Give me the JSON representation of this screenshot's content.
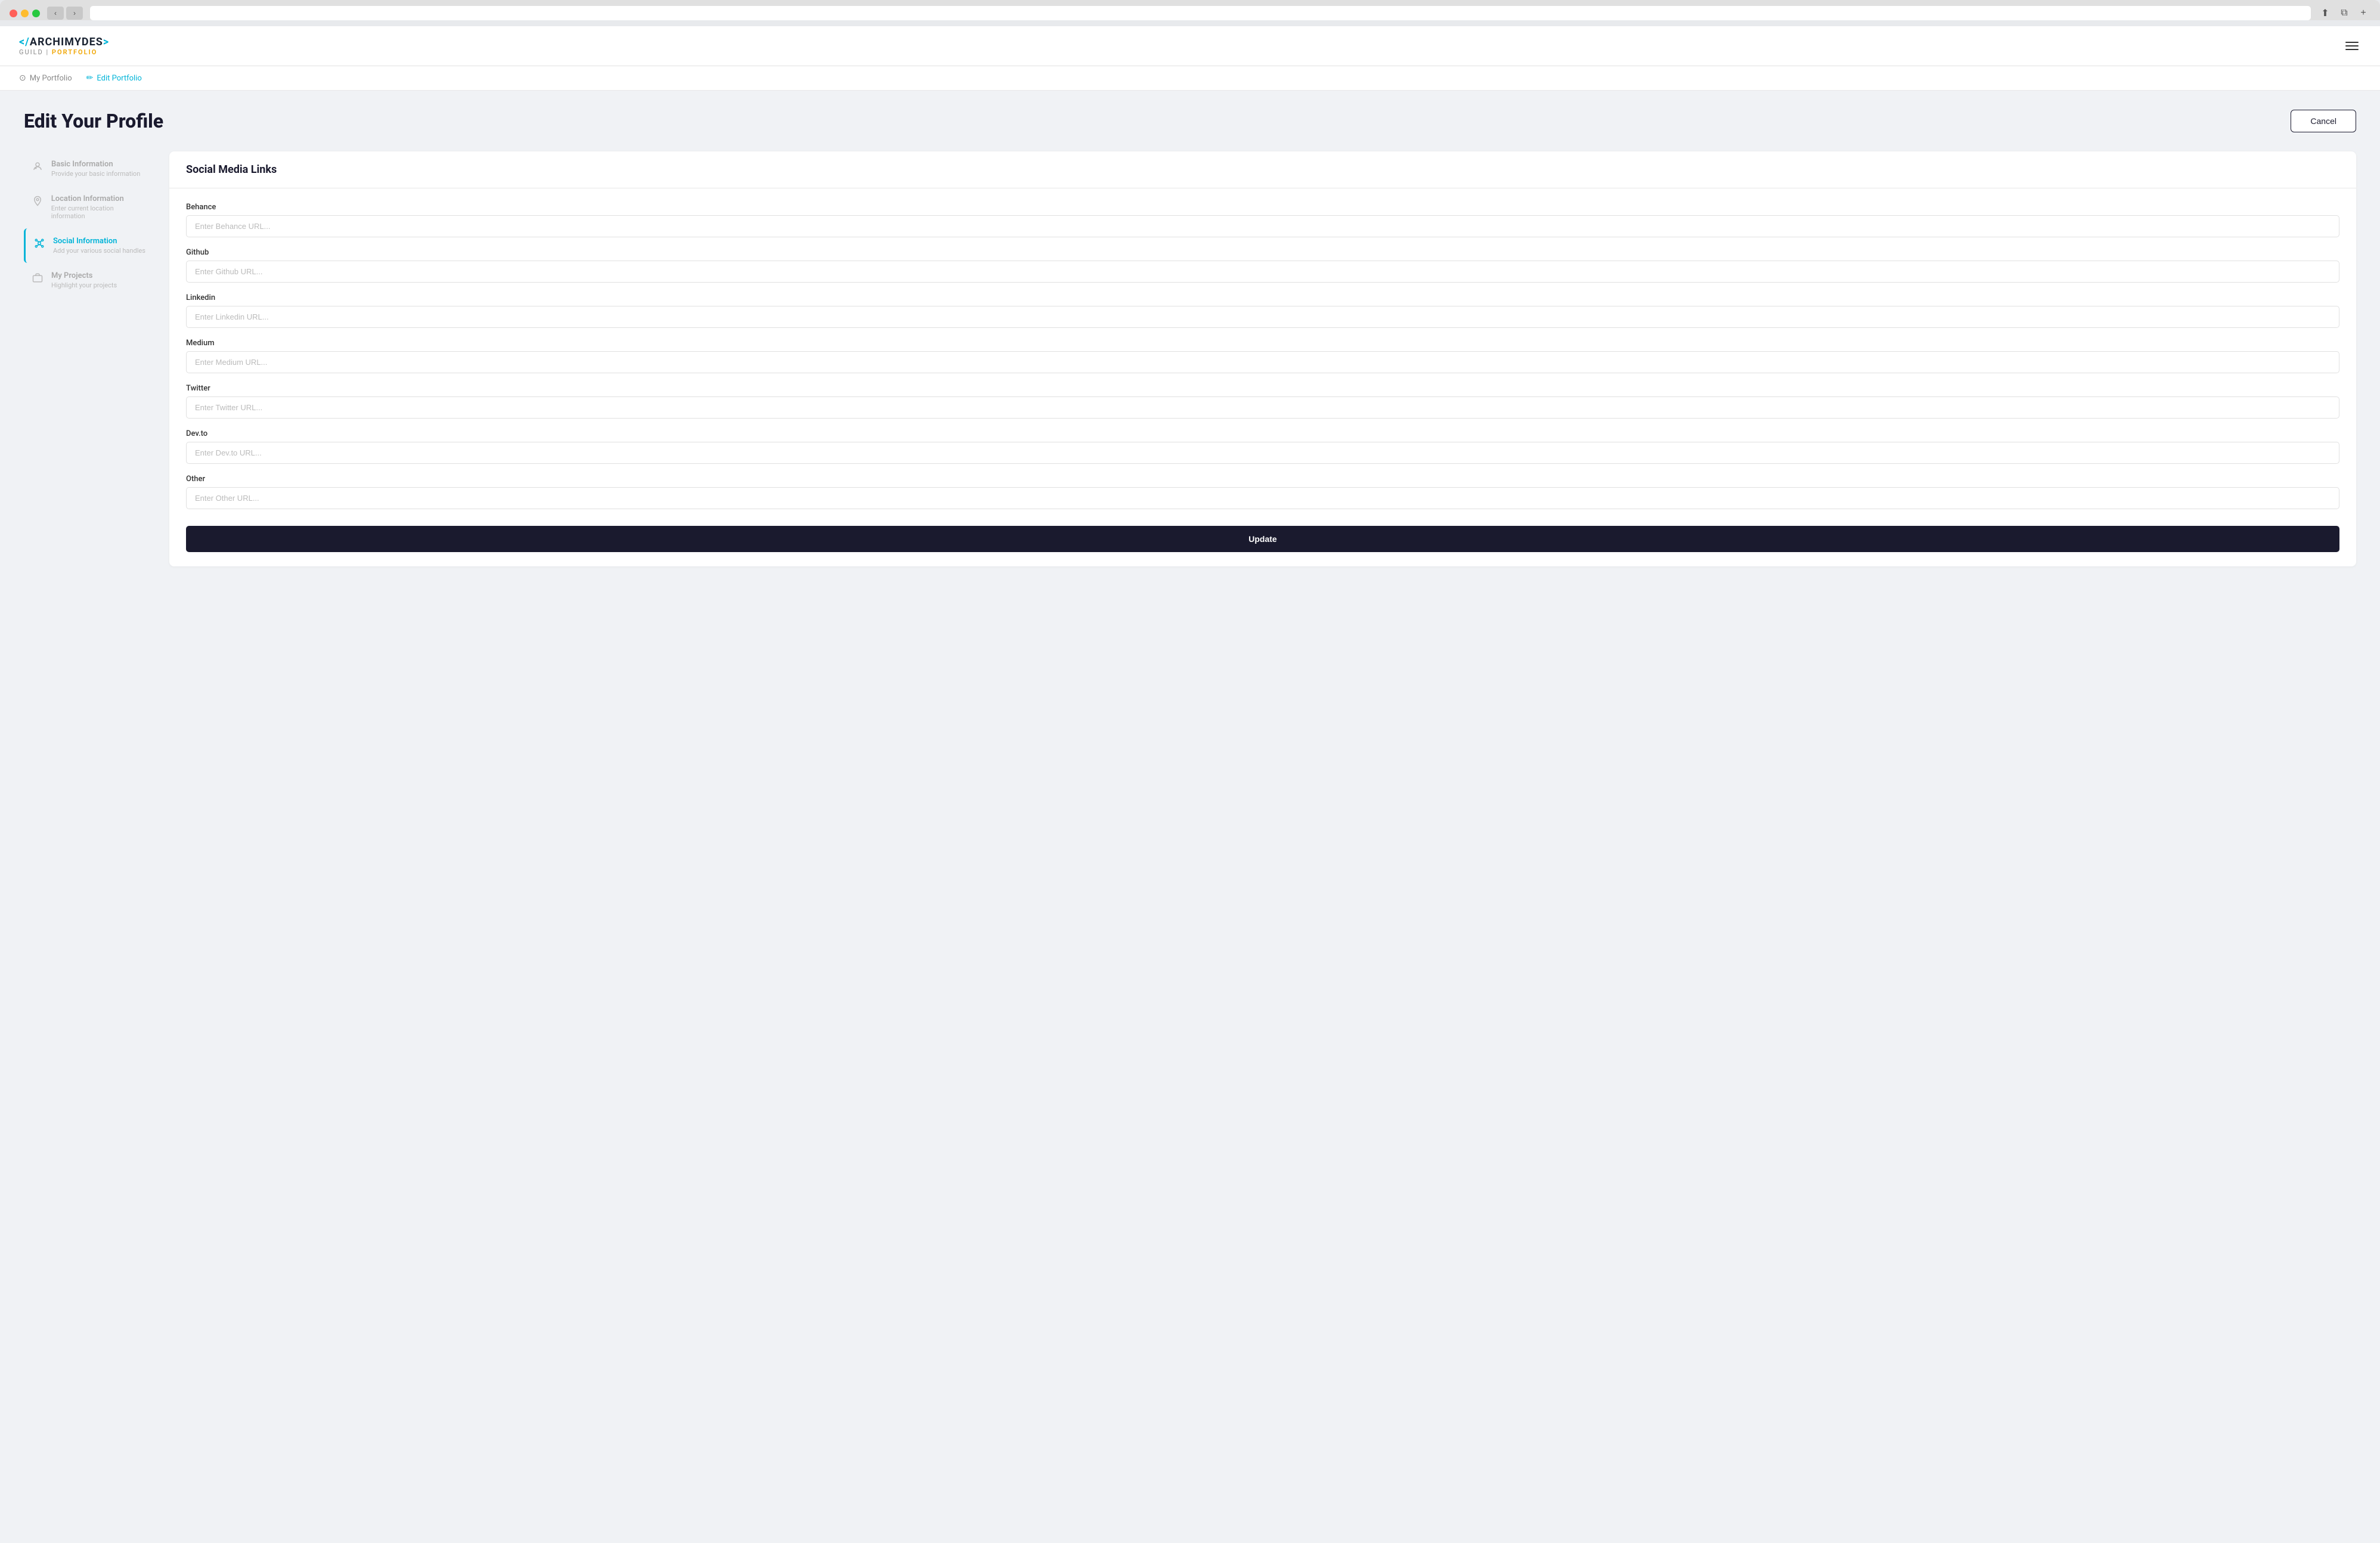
{
  "browser": {
    "back_label": "‹",
    "forward_label": "›",
    "address": "",
    "share_icon": "⬆",
    "duplicate_icon": "⧉",
    "new_tab_icon": "+"
  },
  "nav": {
    "logo_prefix": "</",
    "logo_name": "ARCHIMYDES",
    "logo_suffix": ">",
    "logo_guild": "GUILD",
    "logo_separator": " | ",
    "logo_portfolio": "PORTFOLIO",
    "hamburger_label": "Menu"
  },
  "sub_nav": {
    "my_portfolio_label": "My Portfolio",
    "edit_portfolio_label": "Edit Portfolio"
  },
  "page": {
    "title": "Edit Your Profile",
    "cancel_label": "Cancel"
  },
  "sidebar": {
    "items": [
      {
        "id": "basic-information",
        "title": "Basic Information",
        "subtitle": "Provide your basic information",
        "icon": "person"
      },
      {
        "id": "location-information",
        "title": "Location Information",
        "subtitle": "Enter current location information",
        "icon": "location"
      },
      {
        "id": "social-information",
        "title": "Social Information",
        "subtitle": "Add your various social handles",
        "icon": "social",
        "active": true
      },
      {
        "id": "my-projects",
        "title": "My Projects",
        "subtitle": "Highlight your projects",
        "icon": "briefcase"
      }
    ]
  },
  "form": {
    "panel_title": "Social Media Links",
    "fields": [
      {
        "id": "behance",
        "label": "Behance",
        "placeholder": "Enter Behance URL..."
      },
      {
        "id": "github",
        "label": "Github",
        "placeholder": "Enter Github URL..."
      },
      {
        "id": "linkedin",
        "label": "Linkedin",
        "placeholder": "Enter Linkedin URL..."
      },
      {
        "id": "medium",
        "label": "Medium",
        "placeholder": "Enter Medium URL..."
      },
      {
        "id": "twitter",
        "label": "Twitter",
        "placeholder": "Enter Twitter URL..."
      },
      {
        "id": "devto",
        "label": "Dev.to",
        "placeholder": "Enter Dev.to URL..."
      },
      {
        "id": "other",
        "label": "Other",
        "placeholder": "Enter Other URL..."
      }
    ],
    "update_label": "Update"
  }
}
